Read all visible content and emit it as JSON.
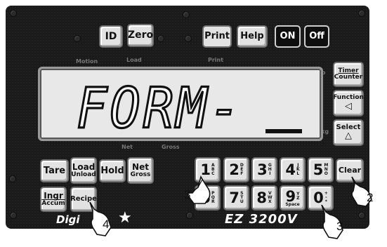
{
  "top_row": {
    "id_label": "ID",
    "zero_label": "Zero",
    "print_label": "Print",
    "help_label": "Help",
    "on_label": "ON",
    "off_label": "Off"
  },
  "indicators": {
    "motion": "Motion",
    "load": "Load",
    "print": "Print",
    "lb": "lb",
    "kg": "kg",
    "net": "Net",
    "gross": "Gross"
  },
  "display": {
    "text": "FORM-"
  },
  "right_column": {
    "timer_line1": "Timer",
    "timer_line2": "Counter",
    "function_label": "Function",
    "function_symbol": "◁",
    "select_label": "Select",
    "select_symbol": "△"
  },
  "left_keys": {
    "tare": "Tare",
    "load_line1": "Load",
    "load_line2": "Unload",
    "hold": "Hold",
    "net_line1": "Net",
    "net_line2": "Gross",
    "ingr_line1": "Ingr",
    "ingr_line2": "Accum",
    "recipe": "Recipe"
  },
  "numpad": [
    {
      "digit": "1",
      "letters": [
        "A",
        "B",
        "C"
      ]
    },
    {
      "digit": "2",
      "letters": [
        "D",
        "E",
        "F"
      ]
    },
    {
      "digit": "3",
      "letters": [
        "G",
        "H",
        "I"
      ]
    },
    {
      "digit": "4",
      "letters": [
        "J",
        "K",
        "L"
      ]
    },
    {
      "digit": "5",
      "letters": [
        "M",
        "N",
        "O"
      ]
    },
    {
      "digit": "6",
      "letters": [
        "P",
        "Q",
        "R"
      ]
    },
    {
      "digit": "7",
      "letters": [
        "S",
        "T",
        "U"
      ]
    },
    {
      "digit": "8",
      "letters": [
        "V",
        "W",
        "X"
      ]
    },
    {
      "digit": "9",
      "letters": [
        "Y",
        "Z"
      ],
      "extra": "Space"
    },
    {
      "digit": "0",
      "letters": [
        "+",
        "-",
        "*"
      ]
    }
  ],
  "clear_label": "Clear",
  "brand": {
    "logo": "Digi",
    "star": "★",
    "model": "EZ 3200V"
  },
  "callouts": {
    "c1": "3",
    "c2": "2",
    "c3": "4",
    "c4": "3"
  },
  "icons": [
    "pointing-hand-icon"
  ]
}
